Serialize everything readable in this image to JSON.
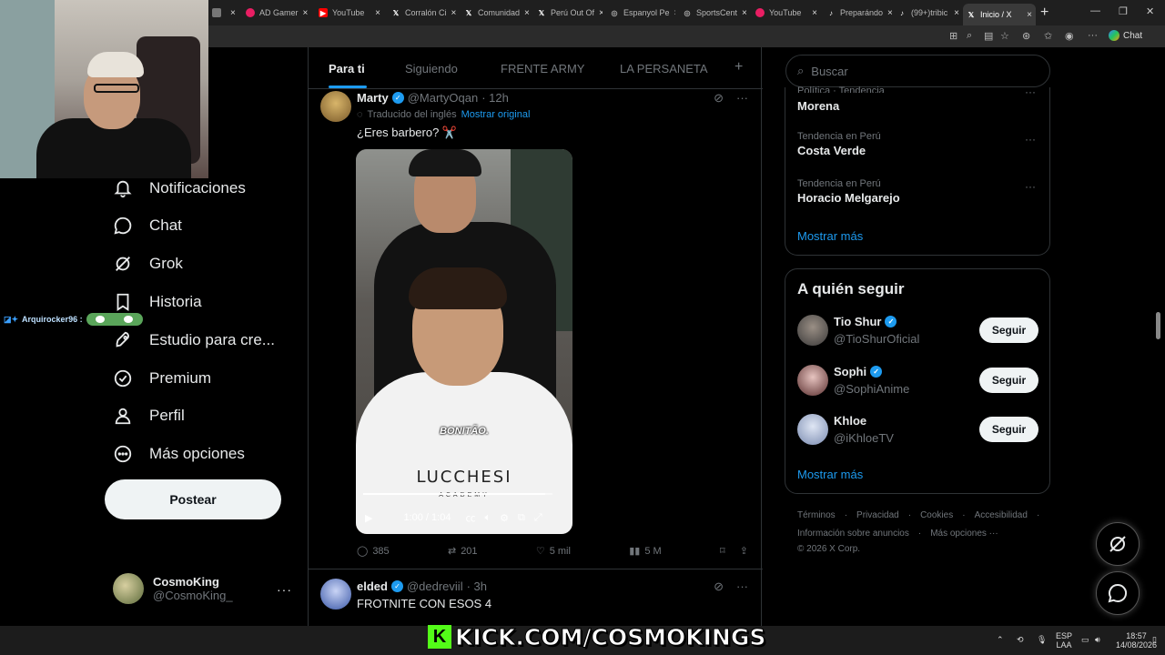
{
  "browser": {
    "tabs": [
      {
        "label": "",
        "icon_color": "#888888"
      },
      {
        "label": "AD Gamer",
        "icon_color": "#e91e63"
      },
      {
        "label": "YouTube",
        "icon_color": "#ff0000"
      },
      {
        "label": "Corralón Ci",
        "icon_color": "#ffffff"
      },
      {
        "label": "Comunidad",
        "icon_color": "#ffffff"
      },
      {
        "label": "Perú Out Of",
        "icon_color": "#ffffff"
      },
      {
        "label": "Espanyol Pe",
        "icon_color": "#ffffff"
      },
      {
        "label": "SportsCent",
        "icon_color": "#ffffff"
      },
      {
        "label": "YouTube",
        "icon_color": "#ff0000"
      },
      {
        "label": "Preparándo",
        "icon_color": "#ffffff"
      },
      {
        "label": "(99+)tribic",
        "icon_color": "#ffffff"
      },
      {
        "label": "Inicio / X",
        "icon_color": "#ffffff"
      }
    ],
    "copilot_label": "Chat"
  },
  "overlay": {
    "chat_user": "Arquirocker96 :",
    "stream_url": "KICK.COM/COSMOKINGS"
  },
  "nav": {
    "items": [
      {
        "label": "Notificaciones",
        "icon": "bell-icon"
      },
      {
        "label": "Chat",
        "icon": "chat-icon"
      },
      {
        "label": "Grok",
        "icon": "grok-icon"
      },
      {
        "label": "Historia",
        "icon": "bookmark-icon"
      },
      {
        "label": "Estudio para cre...",
        "icon": "rocket-icon"
      },
      {
        "label": "Premium",
        "icon": "verified-icon"
      },
      {
        "label": "Perfil",
        "icon": "person-icon"
      },
      {
        "label": "Más opciones",
        "icon": "more-circle-icon"
      }
    ],
    "post_label": "Postear",
    "profile": {
      "name": "CosmoKing",
      "handle": "@CosmoKing_"
    }
  },
  "feed": {
    "tabs": [
      "Para ti",
      "Siguiendo",
      "FRENTE ARMY",
      "LA PERSANETA"
    ],
    "active_tab": "Para ti",
    "tweets": [
      {
        "name": "Marty",
        "handle": "@MartyOqan",
        "time": "· 12h",
        "translation_note": "Traducido del inglés",
        "show_original": "Mostrar original",
        "text": "¿Eres barbero? ✂️",
        "video": {
          "caption": "BONITÃO.",
          "brand": "LUCCHESI",
          "brand_sub": "ACADEMY",
          "time": "1:00 / 1:04",
          "progress": 0.96
        },
        "replies": "385",
        "retweets": "201",
        "likes": "5 mil",
        "views": "5 M"
      },
      {
        "name": "elded",
        "handle": "@dedreviil",
        "time": "· 3h",
        "text": "FROTNITE CON ESOS 4"
      }
    ]
  },
  "sidebar": {
    "search_placeholder": "Buscar",
    "trends": [
      {
        "context": "Política · Tendencia",
        "name": "Morena"
      },
      {
        "context": "Tendencia en Perú",
        "name": "Costa Verde"
      },
      {
        "context": "Tendencia en Perú",
        "name": "Horacio Melgarejo"
      }
    ],
    "trends_more": "Mostrar más",
    "follow_title": "A quién seguir",
    "follow": [
      {
        "name": "Tio Shur",
        "handle": "@TioShurOficial",
        "button": "Seguir"
      },
      {
        "name": "Sophi",
        "handle": "@SophiAnime",
        "button": "Seguir"
      },
      {
        "name": "Khloe",
        "handle": "@iKhloeTV",
        "button": "Seguir"
      }
    ],
    "follow_more": "Mostrar más",
    "footer": {
      "terms": "Términos",
      "privacy": "Privacidad",
      "cookies": "Cookies",
      "accessibility": "Accesibilidad",
      "ads": "Información sobre anuncios",
      "more": "Más opciones ···",
      "copyright": "© 2026 X Corp."
    }
  },
  "taskbar": {
    "lang": "ESP",
    "lang_sub": "LAA",
    "time": "18:57",
    "date": "14/08/2026"
  }
}
